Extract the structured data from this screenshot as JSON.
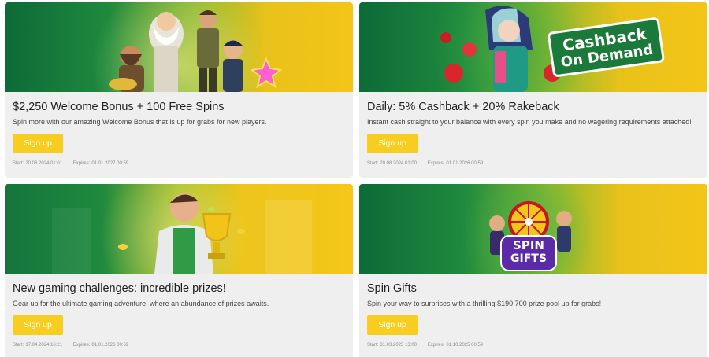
{
  "promotions": [
    {
      "title": "$2,250 Welcome Bonus + 100 Free Spins",
      "description": "Spin more with our amazing Welcome Bonus that is up for grabs for new players.",
      "button_label": "Sign up",
      "start_label": "Start:",
      "start": "20.06.2024 01:01",
      "expires_label": "Expires:",
      "expires": "01.01.2027 00:59",
      "banner_icon": "slot-characters-illustration"
    },
    {
      "title": "Daily: 5% Cashback + 20% Rakeback",
      "description": "Instant cash straight to your balance with every spin you make and no wagering requirements attached!",
      "button_label": "Sign up",
      "start_label": "Start:",
      "start": "20.08.2024 01:00",
      "expires_label": "Expires:",
      "expires": "01.01.2026 00:59",
      "banner_icon": "cashback-character-illustration",
      "banner_text_line1": "Cashback",
      "banner_text_line2": "On Demand"
    },
    {
      "title": "New gaming challenges: incredible prizes!",
      "description": "Gear up for the ultimate gaming adventure, where an abundance of prizes awaits.",
      "button_label": "Sign up",
      "start_label": "Start:",
      "start": "17.04.2024 16:21",
      "expires_label": "Expires:",
      "expires": "01.01.2026 00:59",
      "banner_icon": "trophy-man-illustration"
    },
    {
      "title": "Spin Gifts",
      "description": "Spin your way to surprises with a thrilling $190,700 prize pool up for grabs!",
      "button_label": "Sign up",
      "start_label": "Start:",
      "start": "31.03.2025 13:00",
      "expires_label": "Expires:",
      "expires": "01.10.2025 00:59",
      "banner_icon": "spin-wheel-illustration",
      "banner_text_line1": "SPIN",
      "banner_text_line2": "GIFTS"
    }
  ],
  "colors": {
    "button": "#f8cd1f",
    "card_bg": "#efefef",
    "banner_green": "#0e6a37",
    "banner_yellow": "#f3c517"
  }
}
